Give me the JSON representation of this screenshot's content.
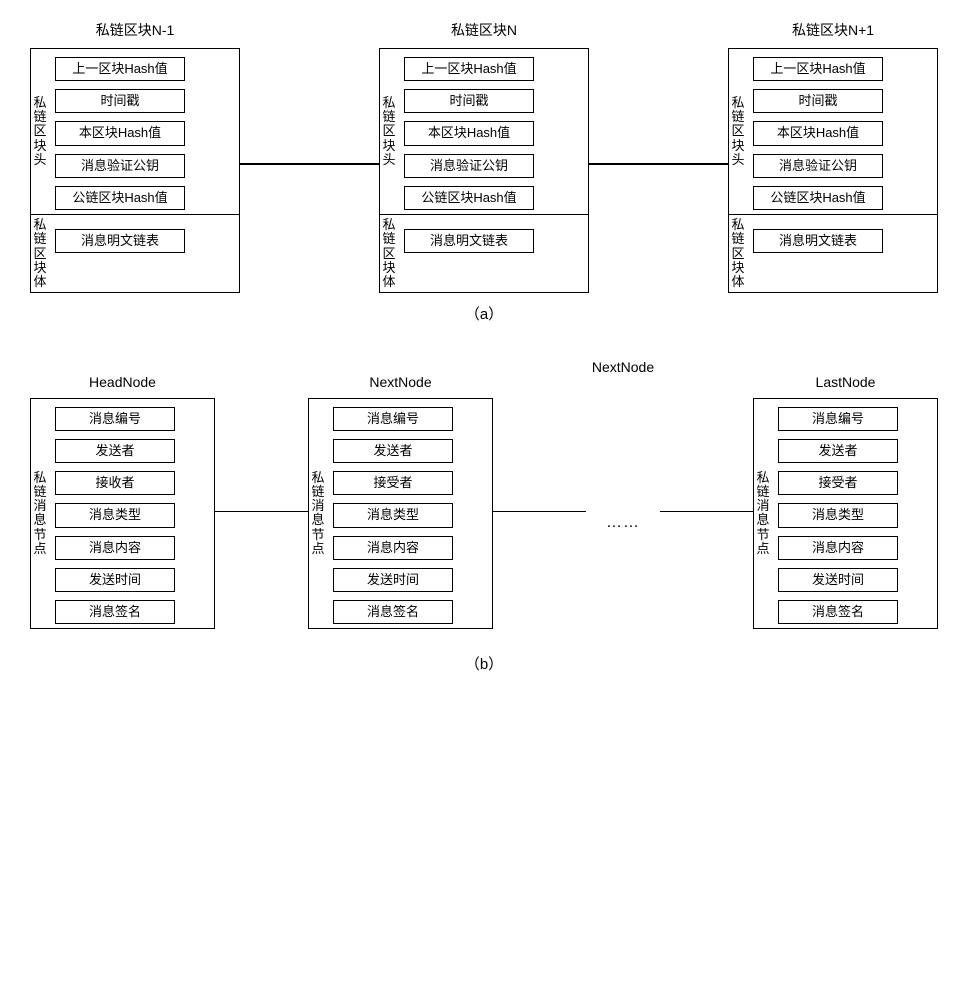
{
  "panelA": {
    "label": "（a）",
    "blocks": [
      {
        "title": "私链区块N-1"
      },
      {
        "title": "私链区块N"
      },
      {
        "title": "私链区块N+1"
      }
    ],
    "header_label": "私链区块头",
    "body_label": "私链区块体",
    "header_fields": [
      "上一区块Hash值",
      "时间戳",
      "本区块Hash值",
      "消息验证公钥",
      "公链区块Hash值"
    ],
    "body_fields": [
      "消息明文链表"
    ]
  },
  "panelB": {
    "label": "（b）",
    "blocks": [
      {
        "title": "HeadNode",
        "fields": [
          "消息编号",
          "发送者",
          "接收者",
          "消息类型",
          "消息内容",
          "发送时间",
          "消息签名"
        ]
      },
      {
        "title": "NextNode",
        "fields": [
          "消息编号",
          "发送者",
          "接受者",
          "消息类型",
          "消息内容",
          "发送时间",
          "消息签名"
        ]
      },
      {
        "title": "NextNode"
      },
      {
        "title": "LastNode",
        "fields": [
          "消息编号",
          "发送者",
          "接受者",
          "消息类型",
          "消息内容",
          "发送时间",
          "消息签名"
        ]
      }
    ],
    "side_label": "私链消息节点",
    "ellipsis": "……"
  }
}
